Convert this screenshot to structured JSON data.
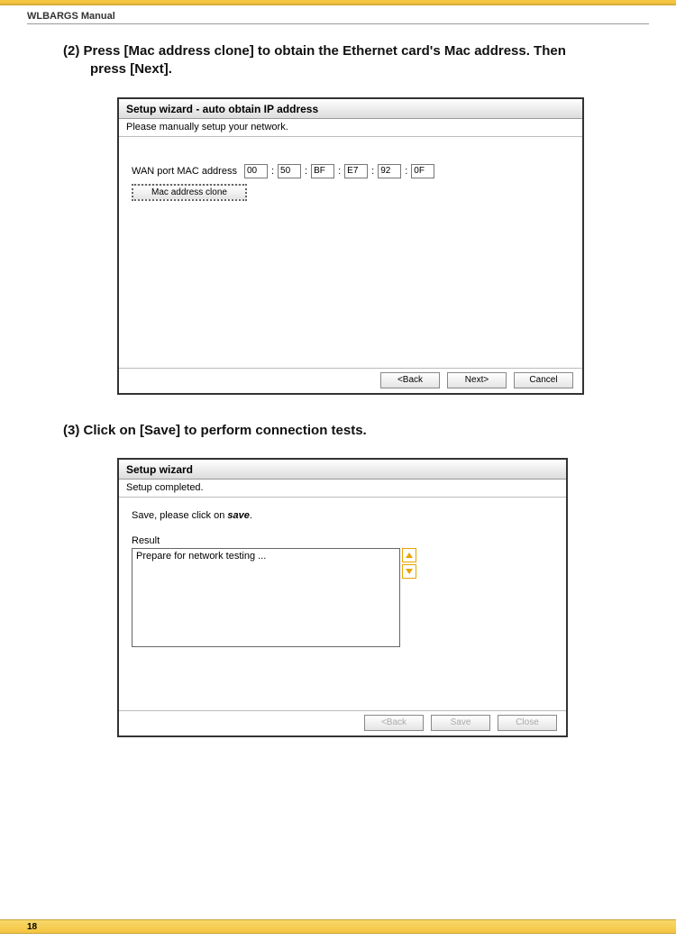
{
  "header": {
    "manual_title": "WLBARGS Manual"
  },
  "step2": {
    "text_line1": "(2) Press [Mac address clone] to obtain the Ethernet card's Mac address. Then",
    "text_line2": "press [Next]."
  },
  "shot1": {
    "title": "Setup wizard - auto obtain IP address",
    "desc": "Please manually setup your network.",
    "mac_label": "WAN port MAC address",
    "mac": [
      "00",
      "50",
      "BF",
      "E7",
      "92",
      "0F"
    ],
    "clone_btn": "Mac address clone",
    "buttons": {
      "back": "<Back",
      "next": "Next>",
      "cancel": "Cancel"
    }
  },
  "step3": {
    "text": "(3) Click on [Save] to perform connection tests."
  },
  "shot2": {
    "title": "Setup wizard",
    "desc": "Setup completed.",
    "save_prefix": "Save, please click on ",
    "save_word": "save",
    "save_suffix": ".",
    "result_label": "Result",
    "result_text": "Prepare for network testing ...",
    "buttons": {
      "back": "<Back",
      "save": "Save",
      "close": "Close"
    }
  },
  "footer": {
    "page_num": "18"
  }
}
